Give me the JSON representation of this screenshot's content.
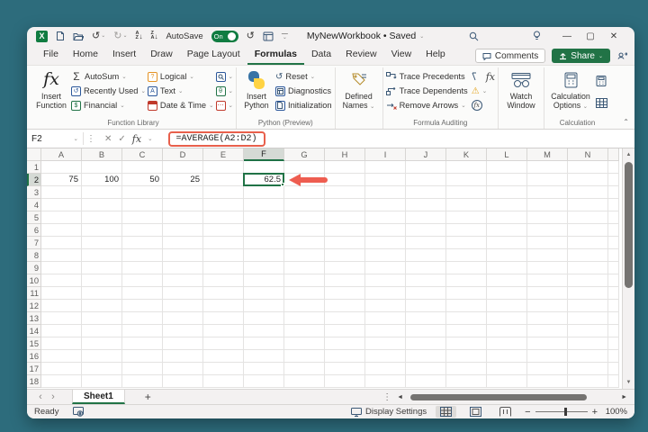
{
  "titlebar": {
    "autosave_label": "AutoSave",
    "autosave_state": "On",
    "title": "MyNewWorkbook • Saved"
  },
  "tabs": {
    "items": [
      "File",
      "Home",
      "Insert",
      "Draw",
      "Page Layout",
      "Formulas",
      "Data",
      "Review",
      "View",
      "Help"
    ],
    "active": "Formulas",
    "comments": "Comments",
    "share": "Share"
  },
  "ribbon": {
    "insert_function": {
      "l1": "Insert",
      "l2": "Function"
    },
    "function_library": {
      "autosum": "AutoSum",
      "recently_used": "Recently Used",
      "financial": "Financial",
      "logical": "Logical",
      "text": "Text",
      "date_time": "Date & Time",
      "label": "Function Library"
    },
    "python": {
      "insert_l1": "Insert",
      "insert_l2": "Python",
      "reset": "Reset",
      "diagnostics": "Diagnostics",
      "initialization": "Initialization",
      "label": "Python (Preview)"
    },
    "defined_names": {
      "l1": "Defined",
      "l2": "Names"
    },
    "auditing": {
      "trace_precedents": "Trace Precedents",
      "trace_dependents": "Trace Dependents",
      "remove_arrows": "Remove Arrows",
      "label": "Formula Auditing"
    },
    "watch": {
      "l1": "Watch",
      "l2": "Window"
    },
    "calculation": {
      "l1": "Calculation",
      "l2": "Options",
      "label": "Calculation"
    }
  },
  "formula_bar": {
    "name_box": "F2",
    "formula": "=AVERAGE(A2:D2)"
  },
  "grid": {
    "columns": [
      "A",
      "B",
      "C",
      "D",
      "E",
      "F",
      "G",
      "H",
      "I",
      "J",
      "K",
      "L",
      "M",
      "N"
    ],
    "row_count": 18,
    "values": {
      "A2": "75",
      "B2": "100",
      "C2": "50",
      "D2": "25",
      "F2": "62.5"
    },
    "selected": {
      "col": "F",
      "row": 2
    }
  },
  "sheet_bar": {
    "active_tab": "Sheet1",
    "add": "+"
  },
  "status_bar": {
    "mode": "Ready",
    "display_settings": "Display Settings",
    "zoom_level": "100%"
  },
  "icons": {
    "chevron_down": "⌄",
    "chevron_up": "⌃",
    "autosum": "Σ",
    "undo": "↺",
    "redo": "↻",
    "refresh": "↺",
    "minimize": "—",
    "maximize": "▢",
    "close": "✕",
    "cancel": "✕",
    "enter": "✓",
    "fx": "fx",
    "warning": "⚠",
    "dots_vertical": "⋮",
    "sort_a": "A",
    "sort_z": "Z",
    "arrow_down": "↓",
    "logical_glyph": "?",
    "text_glyph": "A",
    "math_glyph": "θ",
    "more_glyph": "⋯",
    "recent_glyph": "↺",
    "financial_glyph": "$",
    "nav_left": "‹",
    "nav_right": "›",
    "tri_up": "▲",
    "tri_down": "▼",
    "tri_left": "◄",
    "tri_right": "►",
    "minus": "−",
    "plus": "+",
    "excel_logo": "X"
  }
}
